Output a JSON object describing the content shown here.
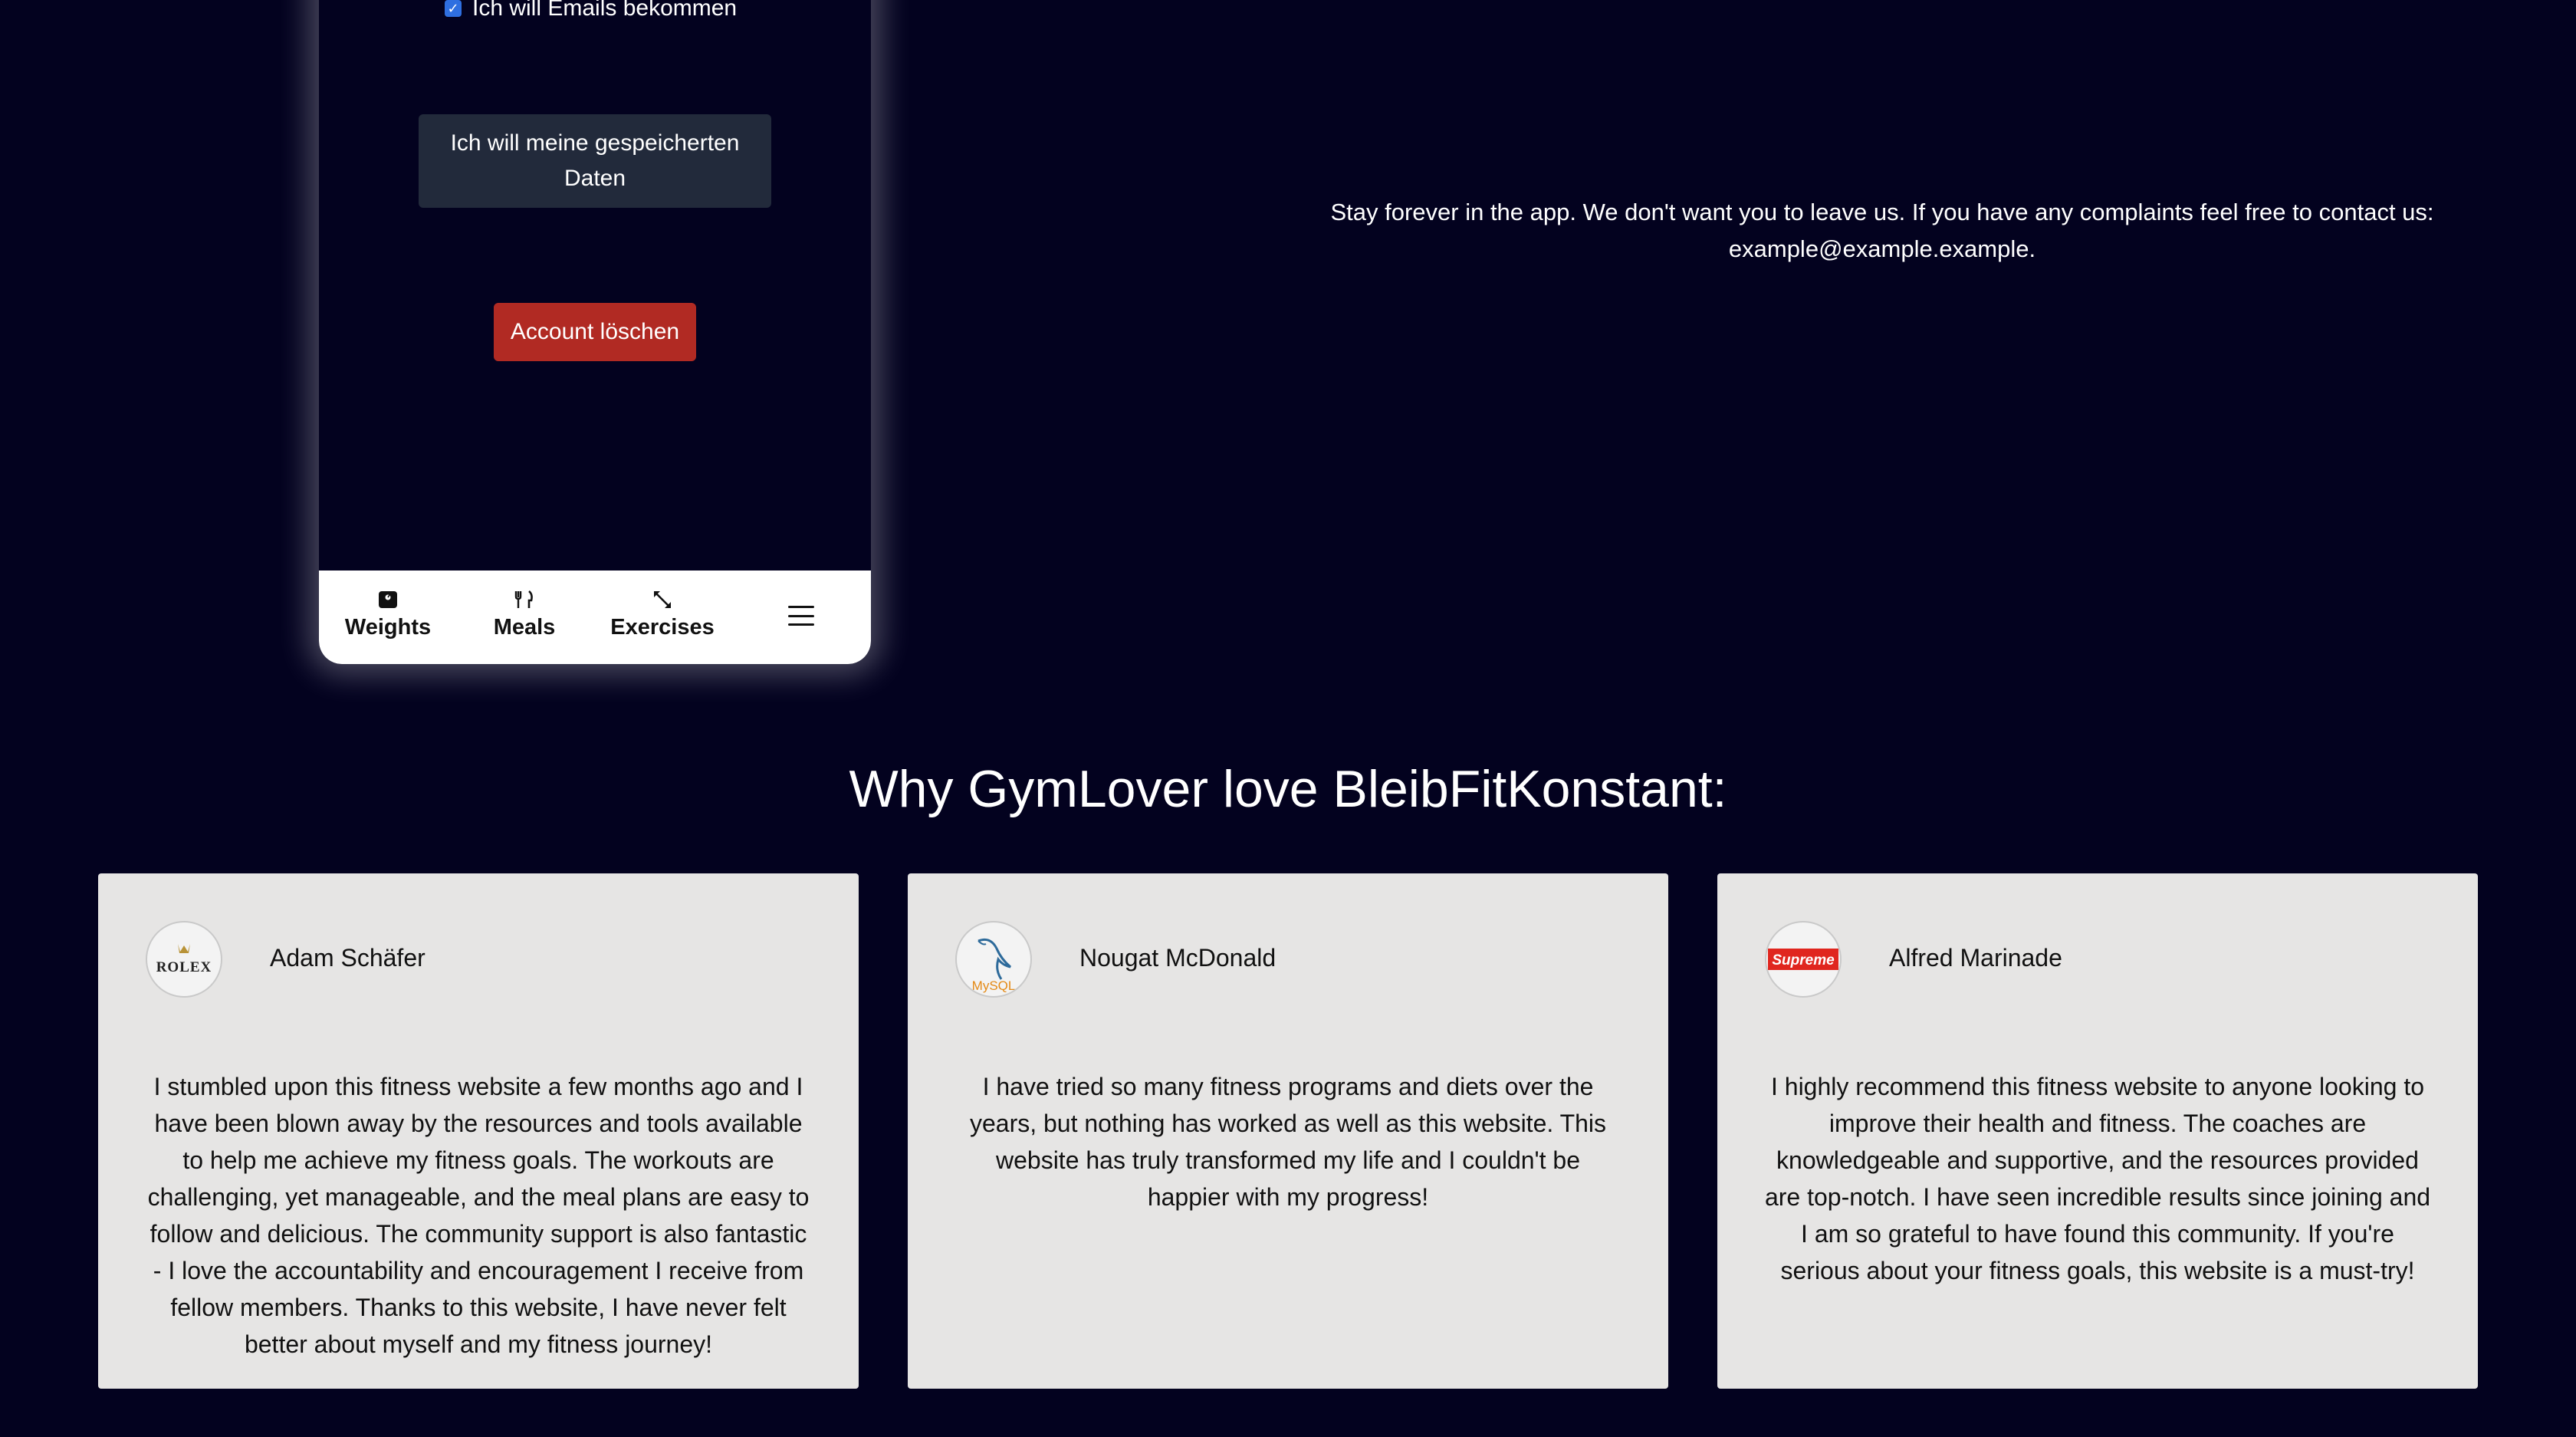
{
  "phone": {
    "email_checkbox_label": "Ich will Emails bekommen",
    "email_checked": true,
    "data_button_label": "Ich will meine gespeicherten Daten",
    "delete_button_label": "Account löschen",
    "nav": {
      "weights": "Weights",
      "meals": "Meals",
      "exercises": "Exercises"
    }
  },
  "contact_text": "Stay forever in the app. We don't want you to leave us. If you have any complaints feel free to contact us: example@example.example.",
  "testimonials": {
    "heading": "Why GymLover love BleibFitKonstant:",
    "items": [
      {
        "author": "Adam Schäfer",
        "logo": "ROLEX",
        "text": "I stumbled upon this fitness website a few months ago and I have been blown away by the resources and tools available to help me achieve my fitness goals. The workouts are challenging, yet manageable, and the meal plans are easy to follow and delicious. The community support is also fantastic - I love the accountability and encouragement I receive from fellow members. Thanks to this website, I have never felt better about myself and my fitness journey!"
      },
      {
        "author": "Nougat McDonald",
        "logo": "MySQL",
        "text": "I have tried so many fitness programs and diets over the years, but nothing has worked as well as this website. This website has truly transformed my life and I couldn't be happier with my progress!"
      },
      {
        "author": "Alfred Marinade",
        "logo": "Supreme",
        "text": "I highly recommend this fitness website to anyone looking to improve their health and fitness. The coaches are knowledgeable and supportive, and the resources provided are top-notch. I have seen incredible results since joining and I am so grateful to have found this community. If you're serious about your fitness goals, this website is a must-try!"
      }
    ]
  },
  "colors": {
    "background": "#03021f",
    "delete_button": "#b12a23",
    "data_button": "#222a3b",
    "card": "#e6e5e4"
  },
  "icons": [
    "scale-icon",
    "utensils-icon",
    "expand-arrows-icon",
    "hamburger-menu-icon",
    "checkbox-checked-icon"
  ]
}
